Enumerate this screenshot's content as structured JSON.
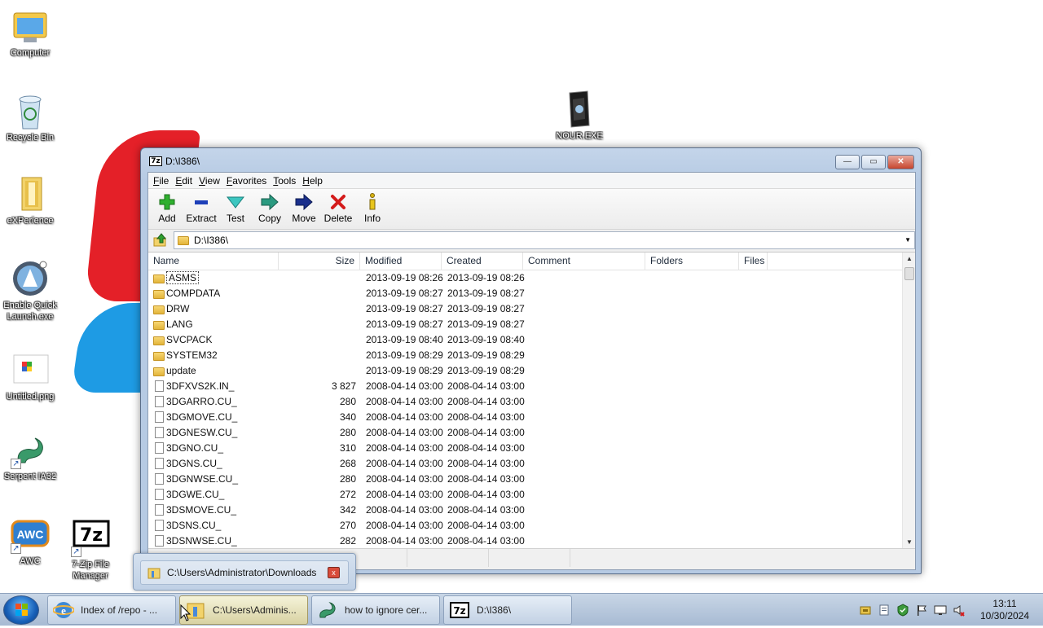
{
  "desktop": {
    "icons": [
      {
        "label": "Computer",
        "icon": "computer-icon"
      },
      {
        "label": "Recycle Bin",
        "icon": "recycle-bin-icon"
      },
      {
        "label": "eXPerience",
        "icon": "folder-icon"
      },
      {
        "label": "Enable Quick Launch.exe",
        "icon": "app-icon"
      },
      {
        "label": "Untitled.png",
        "icon": "image-icon"
      },
      {
        "label": "Serpent IA32",
        "icon": "serpent-icon"
      },
      {
        "label": "AWC",
        "icon": "awc-icon"
      },
      {
        "label": "7-Zip File Manager",
        "icon": "sevenzip-icon"
      },
      {
        "label": "NOUR.EXE",
        "icon": "exe-icon"
      }
    ],
    "icon_glyphs": {
      "awc": "AWC",
      "sevenzip": "7z"
    }
  },
  "window": {
    "title": "D:\\I386\\",
    "app_badge": "7z",
    "controls": {
      "minimize": "—",
      "maximize": "▭",
      "close": "✕"
    },
    "menu": [
      "File",
      "Edit",
      "View",
      "Favorites",
      "Tools",
      "Help"
    ],
    "toolbar": [
      {
        "label": "Add",
        "icon": "add-icon"
      },
      {
        "label": "Extract",
        "icon": "extract-icon"
      },
      {
        "label": "Test",
        "icon": "test-icon"
      },
      {
        "label": "Copy",
        "icon": "copy-icon"
      },
      {
        "label": "Move",
        "icon": "move-icon"
      },
      {
        "label": "Delete",
        "icon": "delete-icon"
      },
      {
        "label": "Info",
        "icon": "info-icon"
      }
    ],
    "address": "D:\\I386\\",
    "columns": [
      "Name",
      "Size",
      "Modified",
      "Created",
      "Comment",
      "Folders",
      "Files"
    ],
    "rows": [
      {
        "type": "folder",
        "name": "ASMS",
        "size": "",
        "modified": "2013-09-19 08:26",
        "created": "2013-09-19 08:26"
      },
      {
        "type": "folder",
        "name": "COMPDATA",
        "size": "",
        "modified": "2013-09-19 08:27",
        "created": "2013-09-19 08:27"
      },
      {
        "type": "folder",
        "name": "DRW",
        "size": "",
        "modified": "2013-09-19 08:27",
        "created": "2013-09-19 08:27"
      },
      {
        "type": "folder",
        "name": "LANG",
        "size": "",
        "modified": "2013-09-19 08:27",
        "created": "2013-09-19 08:27"
      },
      {
        "type": "folder",
        "name": "SVCPACK",
        "size": "",
        "modified": "2013-09-19 08:40",
        "created": "2013-09-19 08:40"
      },
      {
        "type": "folder",
        "name": "SYSTEM32",
        "size": "",
        "modified": "2013-09-19 08:29",
        "created": "2013-09-19 08:29"
      },
      {
        "type": "folder",
        "name": "update",
        "size": "",
        "modified": "2013-09-19 08:29",
        "created": "2013-09-19 08:29"
      },
      {
        "type": "file",
        "name": "3DFXVS2K.IN_",
        "size": "3 827",
        "modified": "2008-04-14 03:00",
        "created": "2008-04-14 03:00"
      },
      {
        "type": "file",
        "name": "3DGARRO.CU_",
        "size": "280",
        "modified": "2008-04-14 03:00",
        "created": "2008-04-14 03:00"
      },
      {
        "type": "file",
        "name": "3DGMOVE.CU_",
        "size": "340",
        "modified": "2008-04-14 03:00",
        "created": "2008-04-14 03:00"
      },
      {
        "type": "file",
        "name": "3DGNESW.CU_",
        "size": "280",
        "modified": "2008-04-14 03:00",
        "created": "2008-04-14 03:00"
      },
      {
        "type": "file",
        "name": "3DGNO.CU_",
        "size": "310",
        "modified": "2008-04-14 03:00",
        "created": "2008-04-14 03:00"
      },
      {
        "type": "file",
        "name": "3DGNS.CU_",
        "size": "268",
        "modified": "2008-04-14 03:00",
        "created": "2008-04-14 03:00"
      },
      {
        "type": "file",
        "name": "3DGNWSE.CU_",
        "size": "280",
        "modified": "2008-04-14 03:00",
        "created": "2008-04-14 03:00"
      },
      {
        "type": "file",
        "name": "3DGWE.CU_",
        "size": "272",
        "modified": "2008-04-14 03:00",
        "created": "2008-04-14 03:00"
      },
      {
        "type": "file",
        "name": "3DSMOVE.CU_",
        "size": "342",
        "modified": "2008-04-14 03:00",
        "created": "2008-04-14 03:00"
      },
      {
        "type": "file",
        "name": "3DSNS.CU_",
        "size": "270",
        "modified": "2008-04-14 03:00",
        "created": "2008-04-14 03:00"
      },
      {
        "type": "file",
        "name": "3DSNWSE.CU_",
        "size": "282",
        "modified": "2008-04-14 03:00",
        "created": "2008-04-14 03:00"
      }
    ],
    "scroll_arrows": {
      "up": "▲",
      "down": "▼"
    },
    "address_drop_arrow": "▼"
  },
  "thumbnail_popup": {
    "label": "C:\\Users\\Administrator\\Downloads",
    "close": "x"
  },
  "taskbar": {
    "buttons": [
      {
        "label": "Index of /repo - ...",
        "icon": "ie-icon",
        "active": false
      },
      {
        "label": "C:\\Users\\Adminis...",
        "icon": "explorer-icon",
        "active": true
      },
      {
        "label": "how to ignore cer...",
        "icon": "serpent-icon",
        "active": false
      },
      {
        "label": "D:\\I386\\",
        "icon": "sevenzip-icon",
        "active": false
      }
    ],
    "tray_icons": [
      "network-icon",
      "document-icon",
      "security-icon",
      "flag-icon",
      "monitor-icon",
      "volume-muted-icon"
    ],
    "time": "13:11",
    "date": "10/30/2024"
  },
  "colors": {
    "red_shape": "#e42028",
    "blue_shape": "#1e9be4",
    "close_button": "#c6452e"
  }
}
